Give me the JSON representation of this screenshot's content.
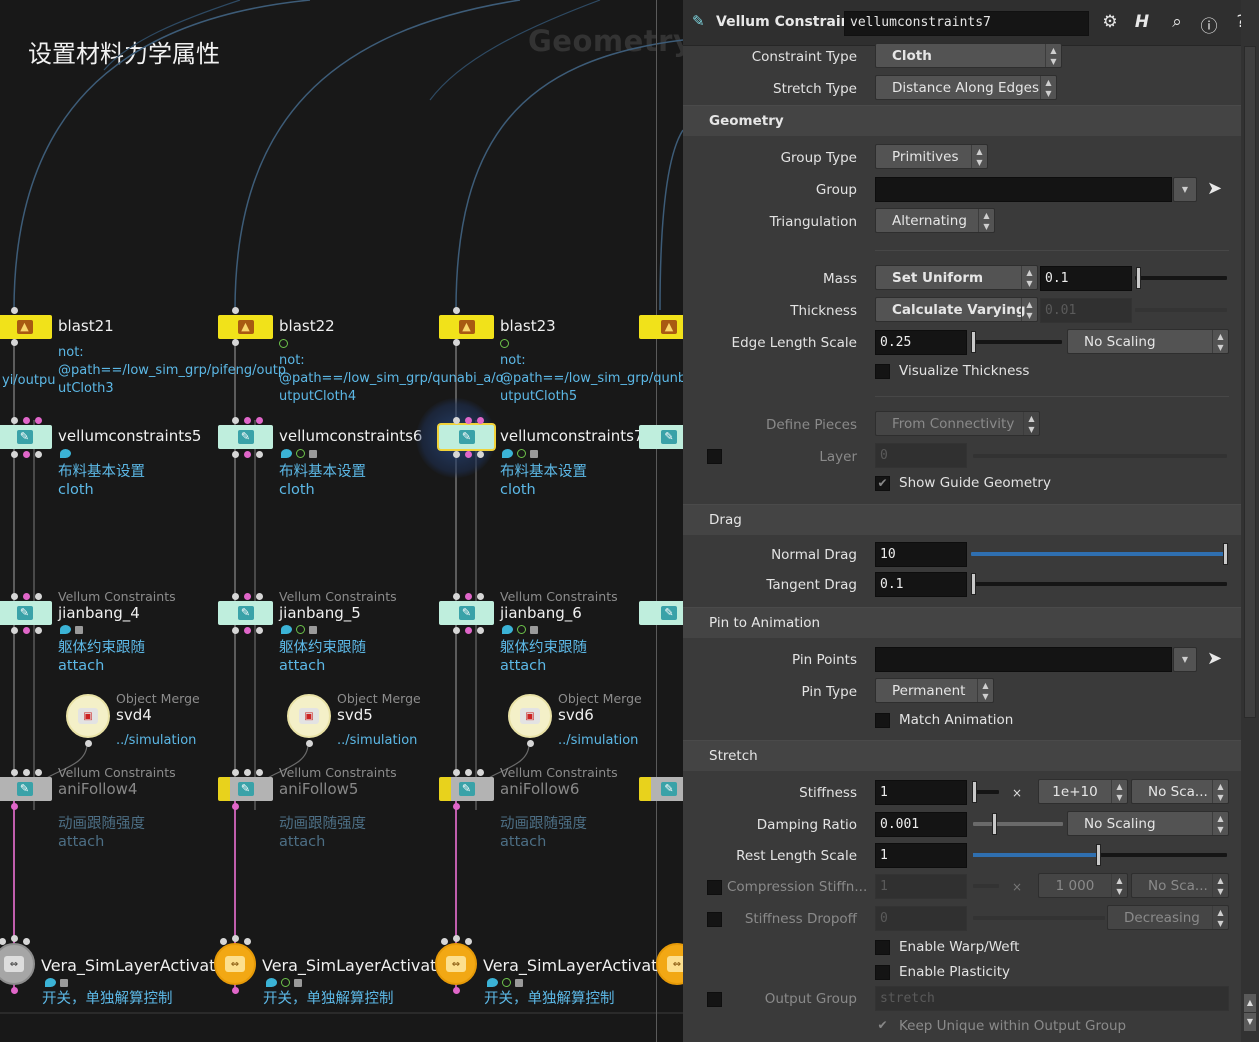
{
  "network": {
    "watermark": "Geometry",
    "overlay_title": "设置材料力学属性",
    "blast_nodes": [
      {
        "name": "blast21",
        "comment_lines": [
          "not:",
          "@path==/low_sim_grp/pifeng/outp",
          "utCloth3"
        ],
        "left_cut": "yi/outpu"
      },
      {
        "name": "blast22",
        "comment_lines": [
          "not:",
          "@path==/low_sim_grp/qunabi_a/o",
          "utputCloth4"
        ]
      },
      {
        "name": "blast23",
        "comment_lines": [
          "not:",
          "@path==/low_sim_grp/qunba",
          "utputCloth5"
        ]
      }
    ],
    "vc_nodes": [
      {
        "name": "vellumconstraints5",
        "cmt1": "布料基本设置",
        "cmt2": "cloth"
      },
      {
        "name": "vellumconstraints6",
        "cmt1": "布料基本设置",
        "cmt2": "cloth"
      },
      {
        "name": "vellumconstraints7",
        "cmt1": "布料基本设置",
        "cmt2": "cloth"
      }
    ],
    "jb_nodes": [
      {
        "type": "Vellum Constraints",
        "name": "jianbang_4",
        "cmt1": "躯体约束跟随",
        "cmt2": "attach"
      },
      {
        "type": "Vellum Constraints",
        "name": "jianbang_5",
        "cmt1": "躯体约束跟随",
        "cmt2": "attach"
      },
      {
        "type": "Vellum Constraints",
        "name": "jianbang_6",
        "cmt1": "躯体约束跟随",
        "cmt2": "attach"
      }
    ],
    "om_nodes": [
      {
        "type": "Object Merge",
        "name": "svd4",
        "path": "../simulation"
      },
      {
        "type": "Object Merge",
        "name": "svd5",
        "path": "../simulation"
      },
      {
        "type": "Object Merge",
        "name": "svd6",
        "path": "../simulation"
      }
    ],
    "af_nodes": [
      {
        "type": "Vellum Constraints",
        "name": "aniFollow4",
        "cmt1": "动画跟随强度",
        "cmt2": "attach"
      },
      {
        "type": "Vellum Constraints",
        "name": "aniFollow5",
        "cmt1": "动画跟随强度",
        "cmt2": "attach"
      },
      {
        "type": "Vellum Constraints",
        "name": "aniFollow6",
        "cmt1": "动画跟随强度",
        "cmt2": "attach"
      }
    ],
    "vera_nodes": [
      {
        "name": "Vera_SimLayerActivation",
        "cmt": "开关，单独解算控制"
      },
      {
        "name": "Vera_SimLayerActivation",
        "cmt": "开关，单独解算控制"
      },
      {
        "name": "Vera_SimLayerActivation",
        "cmt": "开关，单独解算控制"
      }
    ],
    "colors": {
      "pink_wire": "#e066c9",
      "blast": "#f1e21a",
      "vellum": "#bfeedd",
      "comment": "#5cb8e6"
    }
  },
  "panel": {
    "node_type": "Vellum Constraints",
    "node_name": "vellumconstraints7",
    "header_icons": [
      "gear-icon",
      "houdini-help-icon",
      "search-icon",
      "info-icon",
      "question-icon"
    ],
    "constraint_type": {
      "label": "Constraint Type",
      "value": "Cloth"
    },
    "stretch_type": {
      "label": "Stretch Type",
      "value": "Distance Along Edges"
    },
    "geometry": {
      "title": "Geometry",
      "group_type": {
        "label": "Group Type",
        "value": "Primitives"
      },
      "group": {
        "label": "Group",
        "value": ""
      },
      "triangulation": {
        "label": "Triangulation",
        "value": "Alternating"
      },
      "mass": {
        "label": "Mass",
        "mode": "Set Uniform",
        "value": "0.1"
      },
      "thickness": {
        "label": "Thickness",
        "mode": "Calculate Varying",
        "value": "0.01"
      },
      "edge_length_scale": {
        "label": "Edge Length Scale",
        "value": "0.25",
        "scaling": "No Scaling"
      },
      "visualize_thickness": {
        "label": "Visualize Thickness",
        "checked": false
      },
      "define_pieces": {
        "label": "Define Pieces",
        "value": "From Connectivity"
      },
      "layer": {
        "label": "Layer",
        "value": "0"
      },
      "show_guide": {
        "label": "Show Guide Geometry",
        "checked": true,
        "mark": "✔"
      }
    },
    "drag": {
      "title": "Drag",
      "normal_drag": {
        "label": "Normal Drag",
        "value": "10",
        "slider_fraction": 1.0
      },
      "tangent_drag": {
        "label": "Tangent Drag",
        "value": "0.1",
        "slider_fraction": 0.0
      }
    },
    "pin": {
      "title": "Pin to Animation",
      "pin_points": {
        "label": "Pin Points",
        "value": ""
      },
      "pin_type": {
        "label": "Pin Type",
        "value": "Permanent"
      },
      "match_animation": {
        "label": "Match Animation",
        "checked": false
      }
    },
    "stretch": {
      "title": "Stretch",
      "stiffness": {
        "label": "Stiffness",
        "value": "1",
        "mult_sign": "×",
        "mult": "1e+10",
        "scaling": "No Sca..."
      },
      "damping": {
        "label": "Damping Ratio",
        "value": "0.001",
        "scaling": "No Scaling"
      },
      "rest_length": {
        "label": "Rest Length Scale",
        "value": "1",
        "slider_fraction": 0.5
      },
      "compression": {
        "label": "Compression Stiffn...",
        "value": "1",
        "mult_sign": "×",
        "mult": "1 000",
        "scaling": "No Sca..."
      },
      "dropoff": {
        "label": "Stiffness Dropoff",
        "value": "0",
        "mode": "Decreasing"
      },
      "warp_weft": {
        "label": "Enable Warp/Weft",
        "checked": false
      },
      "plasticity": {
        "label": "Enable Plasticity",
        "checked": false
      },
      "output_group": {
        "label": "Output Group",
        "value": "stretch"
      },
      "keep_unique": {
        "label": "Keep Unique within Output Group",
        "checked": true,
        "mark": "✔"
      }
    }
  }
}
